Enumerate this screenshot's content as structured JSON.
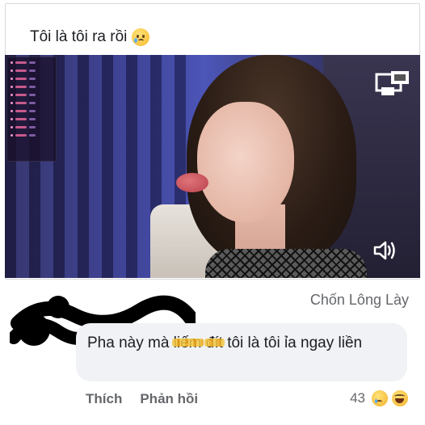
{
  "post": {
    "caption": "Tôi là tôi ra rồi",
    "caption_emoji": "crying-face-emoji"
  },
  "video": {
    "overlay_panel": "stream-stats-overlay",
    "controls": {
      "pip_icon": "picture-in-picture-icon",
      "volume_icon": "speaker-volume-icon"
    }
  },
  "comment": {
    "page_name": "Chốn Lông Lày",
    "text_before": "Pha này mà ",
    "text_censored_1": "liếm",
    "text_between": " ",
    "text_censored_2": "đít",
    "text_after": " tôi là tôi ỉa ngay liền",
    "actions": {
      "like_label": "Thích",
      "reply_label": "Phản hồi"
    },
    "reactions": {
      "count": "43",
      "icons": [
        "sad-reaction-icon",
        "haha-reaction-icon"
      ]
    }
  },
  "colors": {
    "bubble_bg": "#f0f2f5",
    "meta_text": "#65676b",
    "censor": "#f5c842"
  }
}
